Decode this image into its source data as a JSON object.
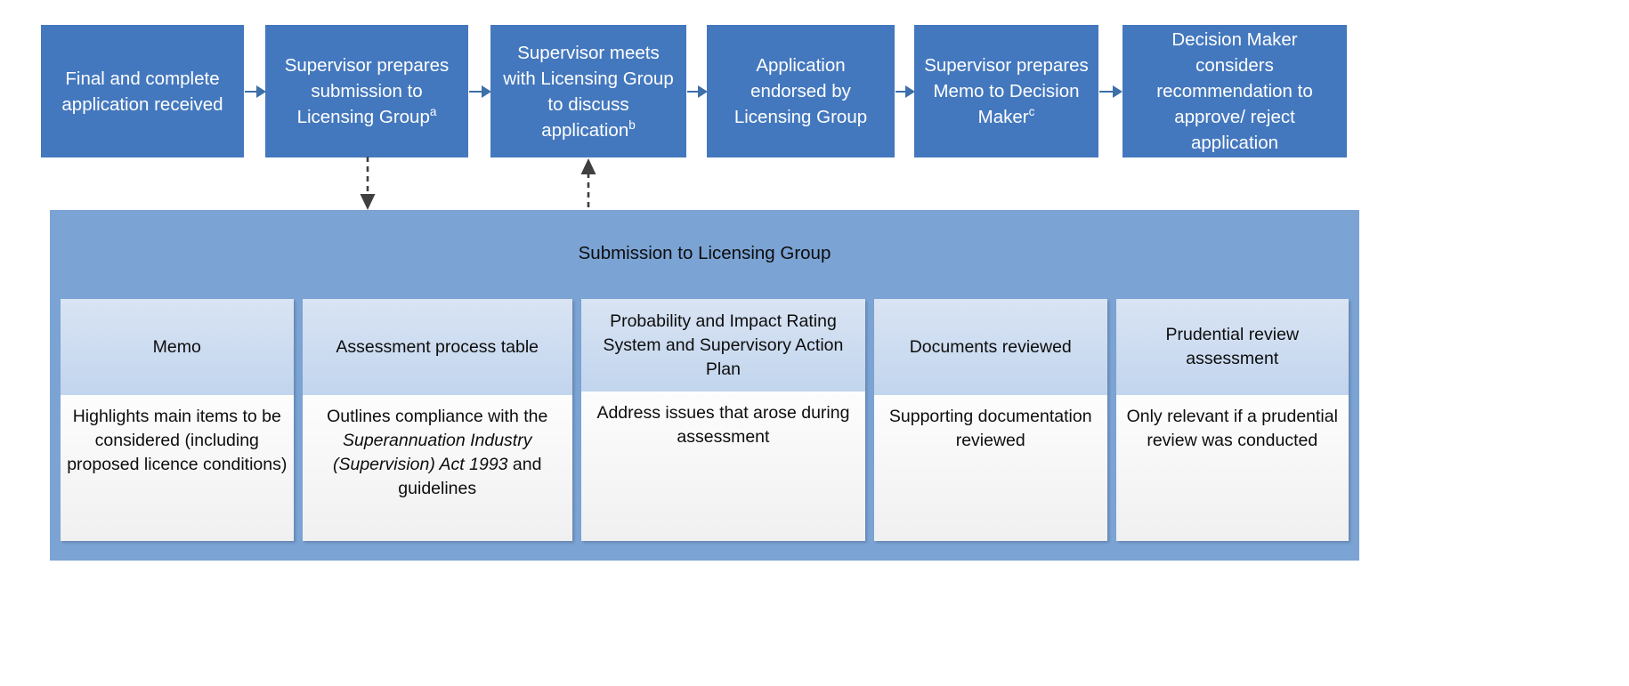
{
  "diagram": {
    "title": "Submission to Licensing Group",
    "colors": {
      "process_box": "#4478be",
      "panel": "#7ba3d4",
      "card_header": "#c2d5ee",
      "card_body": "#f2f2f2",
      "arrow": "#3e6fa8",
      "dashed_arrow": "#404040",
      "box_text": "#ffffff",
      "body_text": "#0d0d0d"
    }
  },
  "process_steps": [
    {
      "id": "step-1",
      "text": "Final and complete application received",
      "footnote": ""
    },
    {
      "id": "step-2",
      "text": "Supervisor prepares submission to Licensing Group",
      "footnote": "a"
    },
    {
      "id": "step-3",
      "text": "Supervisor meets with Licensing Group to discuss application",
      "footnote": "b"
    },
    {
      "id": "step-4",
      "text": "Application endorsed by Licensing Group",
      "footnote": ""
    },
    {
      "id": "step-5",
      "text": "Supervisor prepares Memo to Decision Maker",
      "footnote": "c"
    },
    {
      "id": "step-6",
      "text": "Decision Maker considers recommendation to approve/ reject application",
      "footnote": ""
    }
  ],
  "connectors": {
    "solid_arrows": 5,
    "dashed_down_from": "step-2",
    "dashed_up_to": "step-3"
  },
  "panel": {
    "title": "Submission to Licensing Group",
    "cards": [
      {
        "id": "card-memo",
        "header": "Memo",
        "body_plain": "Highlights main items to be considered (including proposed licence conditions)",
        "body_parts": [
          {
            "text": "Highlights main items to be considered (including proposed licence conditions)",
            "italic": false
          }
        ]
      },
      {
        "id": "card-assessment-process-table",
        "header": "Assessment process table",
        "body_plain": "Outlines compliance with the Superannuation Industry (Supervision) Act 1993 and guidelines",
        "body_parts": [
          {
            "text": "Outlines compliance with the ",
            "italic": false
          },
          {
            "text": "Superannuation Industry (Supervision) Act 1993",
            "italic": true
          },
          {
            "text": " and guidelines",
            "italic": false
          }
        ]
      },
      {
        "id": "card-pirs-sap",
        "header": "Probability and Impact Rating System and Supervisory Action Plan",
        "body_plain": "Address issues that arose during assessment",
        "body_parts": [
          {
            "text": "Address issues that arose during assessment",
            "italic": false
          }
        ]
      },
      {
        "id": "card-documents-reviewed",
        "header": "Documents reviewed",
        "body_plain": "Supporting documentation reviewed",
        "body_parts": [
          {
            "text": "Supporting documentation reviewed",
            "italic": false
          }
        ]
      },
      {
        "id": "card-prudential-review-assessment",
        "header": "Prudential review assessment",
        "body_plain": "Only relevant if a prudential review was conducted",
        "body_parts": [
          {
            "text": "Only relevant if a prudential review was conducted",
            "italic": false
          }
        ]
      }
    ]
  }
}
